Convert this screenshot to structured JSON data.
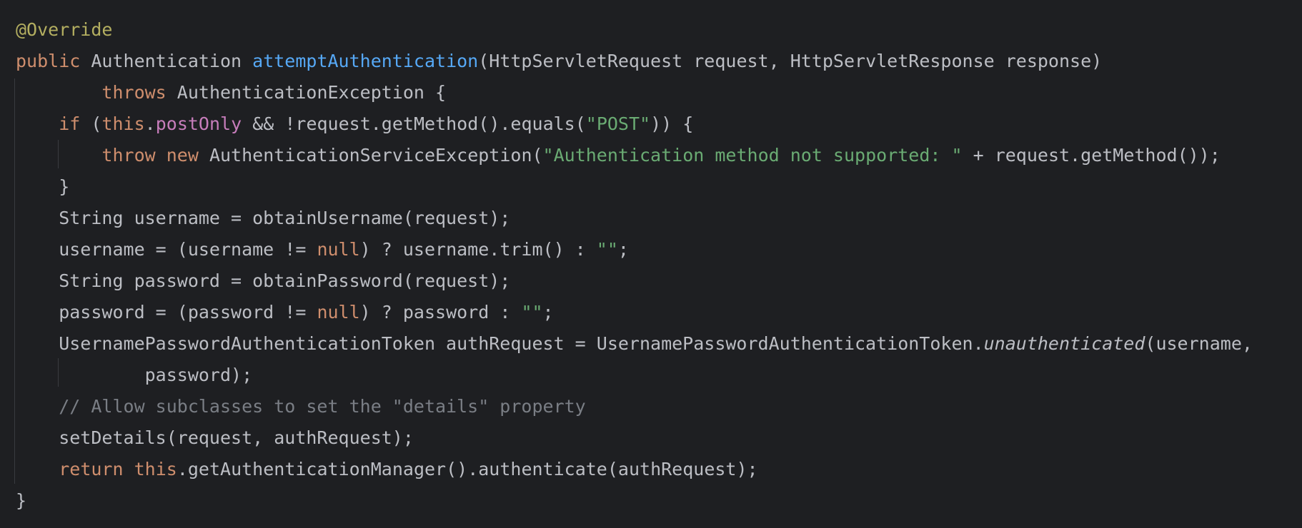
{
  "editor": {
    "lines": [
      [
        {
          "t": "@Override",
          "c": "ann"
        }
      ],
      [
        {
          "t": "public",
          "c": "kw"
        },
        {
          "t": " Authentication ",
          "c": "p"
        },
        {
          "t": "attemptAuthentication",
          "c": "fn"
        },
        {
          "t": "(HttpServletRequest request, HttpServletResponse response)",
          "c": "p"
        }
      ],
      [
        {
          "t": "        ",
          "c": "p"
        },
        {
          "t": "throws",
          "c": "kw"
        },
        {
          "t": " AuthenticationException {",
          "c": "p"
        }
      ],
      [
        {
          "t": "    ",
          "c": "p"
        },
        {
          "t": "if",
          "c": "kw"
        },
        {
          "t": " (",
          "c": "p"
        },
        {
          "t": "this",
          "c": "kw"
        },
        {
          "t": ".",
          "c": "p"
        },
        {
          "t": "postOnly",
          "c": "fld"
        },
        {
          "t": " && !request.getMethod().equals(",
          "c": "p"
        },
        {
          "t": "\"POST\"",
          "c": "str"
        },
        {
          "t": ")) {",
          "c": "p"
        }
      ],
      [
        {
          "t": "        ",
          "c": "p"
        },
        {
          "t": "throw",
          "c": "kw"
        },
        {
          "t": " ",
          "c": "p"
        },
        {
          "t": "new",
          "c": "kw"
        },
        {
          "t": " AuthenticationServiceException(",
          "c": "p"
        },
        {
          "t": "\"Authentication method not supported: \"",
          "c": "str"
        },
        {
          "t": " + request.getMethod());",
          "c": "p"
        }
      ],
      [
        {
          "t": "    }",
          "c": "p"
        }
      ],
      [
        {
          "t": "    String username = obtainUsername(request);",
          "c": "p"
        }
      ],
      [
        {
          "t": "    username = (username != ",
          "c": "p"
        },
        {
          "t": "null",
          "c": "kw"
        },
        {
          "t": ") ? username.trim() : ",
          "c": "p"
        },
        {
          "t": "\"\"",
          "c": "str"
        },
        {
          "t": ";",
          "c": "p"
        }
      ],
      [
        {
          "t": "    String password = obtainPassword(request);",
          "c": "p"
        }
      ],
      [
        {
          "t": "    password = (password != ",
          "c": "p"
        },
        {
          "t": "null",
          "c": "kw"
        },
        {
          "t": ") ? password : ",
          "c": "p"
        },
        {
          "t": "\"\"",
          "c": "str"
        },
        {
          "t": ";",
          "c": "p"
        }
      ],
      [
        {
          "t": "    UsernamePasswordAuthenticationToken authRequest = UsernamePasswordAuthenticationToken.",
          "c": "p"
        },
        {
          "t": "unauthenticated",
          "c": "st"
        },
        {
          "t": "(username,",
          "c": "p"
        }
      ],
      [
        {
          "t": "            password);",
          "c": "p"
        }
      ],
      [
        {
          "t": "    // Allow subclasses to set the \"details\" property",
          "c": "cmt"
        }
      ],
      [
        {
          "t": "    setDetails(request, authRequest);",
          "c": "p"
        }
      ],
      [
        {
          "t": "    ",
          "c": "p"
        },
        {
          "t": "return",
          "c": "kw"
        },
        {
          "t": " ",
          "c": "p"
        },
        {
          "t": "this",
          "c": "kw"
        },
        {
          "t": ".getAuthenticationManager().authenticate(authRequest);",
          "c": "p"
        }
      ],
      [
        {
          "t": "}",
          "c": "p"
        }
      ]
    ],
    "colors": {
      "background": "#1e1f22",
      "default": "#bcbec4",
      "keyword": "#cf8e6d",
      "method_declaration": "#56a8f5",
      "string": "#6aab73",
      "field": "#c77dbb",
      "annotation": "#b3ae60",
      "comment": "#7a7e85",
      "indent_guide": "#393b40"
    }
  }
}
